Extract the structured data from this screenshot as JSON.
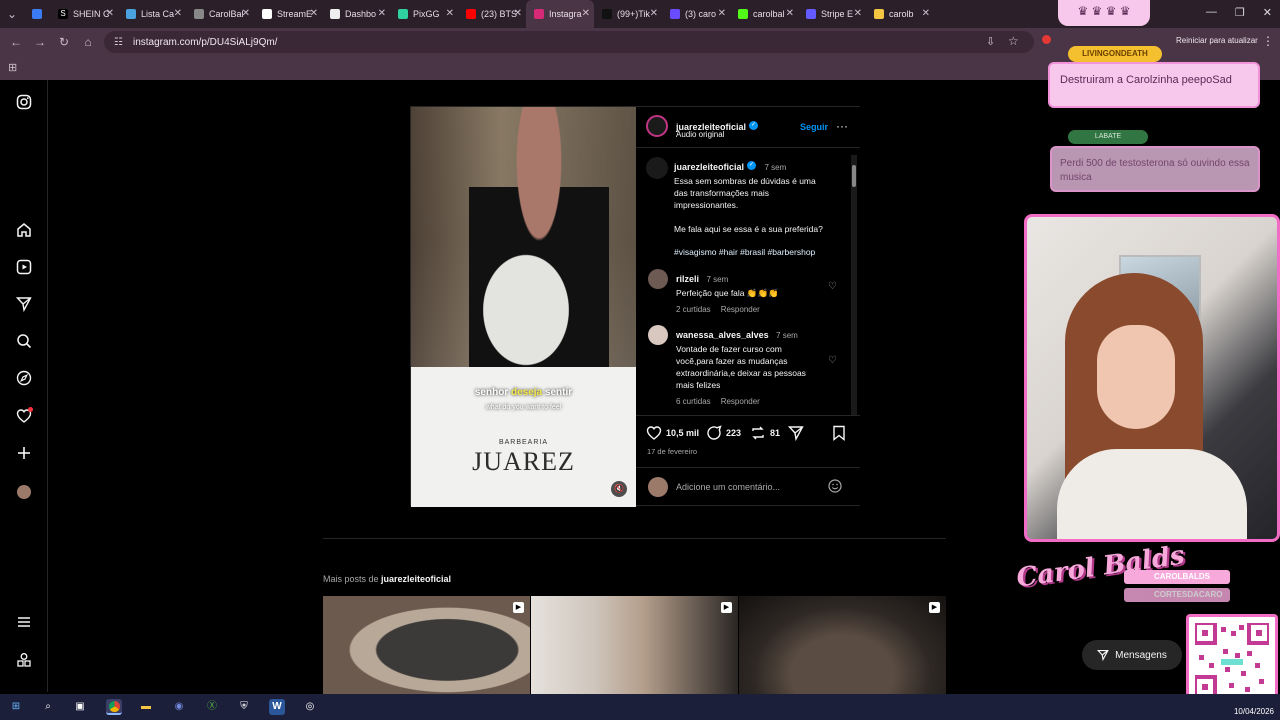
{
  "browser": {
    "tabs": [
      {
        "label": "",
        "fav_color": "#3b7cf5"
      },
      {
        "label": "SHEIN C",
        "fav_color": "#000000",
        "fav_char": "S"
      },
      {
        "label": "Lista Ca",
        "fav_color": "#4aa3df"
      },
      {
        "label": "CarolBal",
        "fav_color": "#888888"
      },
      {
        "label": "StreamE",
        "fav_color": "#ffffff"
      },
      {
        "label": "Dashbo",
        "fav_color": "#eeeeee"
      },
      {
        "label": "PixGG",
        "fav_color": "#2fd1a0"
      },
      {
        "label": "(23) BTS",
        "fav_color": "#ff0000"
      },
      {
        "label": "Instagra",
        "fav_color": "#d62976",
        "active": true
      },
      {
        "label": "(99+)Tik",
        "fav_color": "#111111"
      },
      {
        "label": "(3) caro",
        "fav_color": "#6a4cff"
      },
      {
        "label": "carolbal",
        "fav_color": "#53fc18"
      },
      {
        "label": "Stripe E",
        "fav_color": "#635bff"
      },
      {
        "label": "carolb",
        "fav_color": "#f4c542"
      }
    ],
    "url": "instagram.com/p/DU4SiALj9Qm/",
    "update_label": "Reiniciar para atualizar"
  },
  "post": {
    "author": "juarezleiteoficial",
    "audio": "Áudio original",
    "follow_label": "Seguir",
    "caption_time": "7 sem",
    "caption_line1": "Essa sem sombras de dúvidas é uma",
    "caption_line2": "das transformações mais",
    "caption_line3": "impressionantes.",
    "caption_question": "Me fala aqui se essa é a sua preferida?",
    "hashtags": "#visagismo #hair #brasil #barbershop",
    "comments": [
      {
        "user": "rilzeli",
        "time": "7 sem",
        "text": "Perfeição que fala 👏👏👏",
        "likes": "2 curtidas",
        "reply": "Responder"
      },
      {
        "user": "wanessa_alves_alves",
        "time": "7 sem",
        "text_lines": [
          "Vontade de fazer curso com",
          "você,para fazer as mudanças",
          "extraordinária,e deixar as pessoas",
          "mais felizes"
        ],
        "likes": "6 curtidas",
        "reply": "Responder"
      }
    ],
    "like_count": "10,5 mil",
    "comment_count": "223",
    "repost_count": "81",
    "date": "17 de fevereiro",
    "comment_placeholder": "Adicione um comentário...",
    "video_subtitle_pre": "senhor ",
    "video_subtitle_hl": "deseja",
    "video_subtitle_post": " sentir",
    "video_subtitle_en": "what do you want to feel",
    "video_brand_small": "BARBEARIA",
    "video_brand": "JUAREZ"
  },
  "more_posts": {
    "label_prefix": "Mais posts de ",
    "author": "juarezleiteoficial"
  },
  "overlay": {
    "chat1_user": "LIVINGONDEATH",
    "chat1_text": "Destruiram a Carolzinha peepoSad",
    "chat2_user": "LABATE",
    "chat2_text": "Perdi 500 de testosterona só ouvindo essa musica",
    "logo_text": "Carol Balds",
    "social1": "CAROLBALDS",
    "social2": "CORTESDACARO",
    "messages_label": "Mensagens"
  },
  "taskbar": {
    "date": "10/04/2026"
  }
}
